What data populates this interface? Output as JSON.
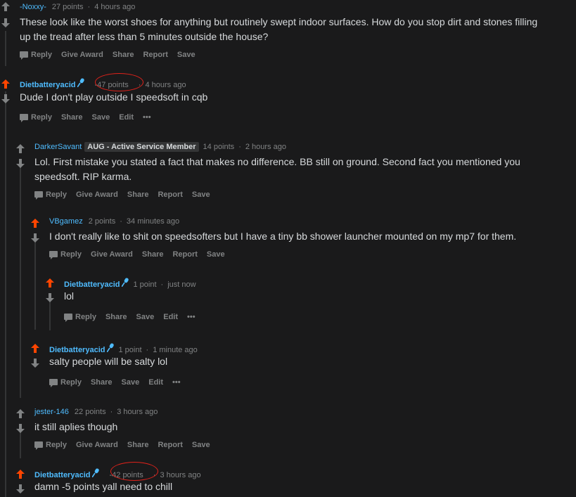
{
  "comments": [
    {
      "user": "-Noxxy-",
      "points": "27 points",
      "time": "4 hours ago",
      "body": [
        "These look like the worst shoes for anything but routinely swept indoor surfaces. How do you stop dirt and stones filling",
        "up the tread after less than 5 minutes outside the house?"
      ],
      "actions": [
        "Reply",
        "Give Award",
        "Share",
        "Report",
        "Save"
      ]
    },
    {
      "user": "Dietbatteryacid",
      "points": "-47 points",
      "time": "4 hours ago",
      "body": [
        "Dude I don't play outside I speedsoft in cqb"
      ],
      "actions": [
        "Reply",
        "Share",
        "Save",
        "Edit",
        "•••"
      ]
    },
    {
      "user": "DarkerSavant",
      "flair": "AUG - Active Service Member",
      "points": "14 points",
      "time": "2 hours ago",
      "body": [
        "Lol. First mistake you stated a fact that makes no difference. BB still on ground. Second fact you mentioned you",
        "speedsoft. RIP karma."
      ],
      "actions": [
        "Reply",
        "Give Award",
        "Share",
        "Report",
        "Save"
      ]
    },
    {
      "user": "VBgamez",
      "points": "2 points",
      "time": "34 minutes ago",
      "body": [
        "I don't really like to shit on speedsofters but I have a tiny bb shower launcher mounted on my mp7 for them."
      ],
      "actions": [
        "Reply",
        "Give Award",
        "Share",
        "Report",
        "Save"
      ]
    },
    {
      "user": "Dietbatteryacid",
      "points": "1 point",
      "time": "just now",
      "body": [
        "lol"
      ],
      "actions": [
        "Reply",
        "Share",
        "Save",
        "Edit",
        "•••"
      ]
    },
    {
      "user": "Dietbatteryacid",
      "points": "1 point",
      "time": "1 minute ago",
      "body": [
        "salty people will be salty lol"
      ],
      "actions": [
        "Reply",
        "Share",
        "Save",
        "Edit",
        "•••"
      ]
    },
    {
      "user": "jester-146",
      "points": "22 points",
      "time": "3 hours ago",
      "body": [
        "it still aplies though"
      ],
      "actions": [
        "Reply",
        "Give Award",
        "Share",
        "Report",
        "Save"
      ]
    },
    {
      "user": "Dietbatteryacid",
      "points": "-42 points",
      "time": "3 hours ago",
      "body": [
        "damn -5 points yall need to chill"
      ],
      "actions": []
    }
  ],
  "colors": {
    "upvoted": "#ff4500",
    "neutral": "#818384",
    "annotation": "#e0221b",
    "user": "#4fbcff"
  },
  "icons": {
    "upvote": "up-arrow-icon",
    "downvote": "down-arrow-icon",
    "reply": "chat-bubble-icon",
    "mic": "mic-icon"
  }
}
